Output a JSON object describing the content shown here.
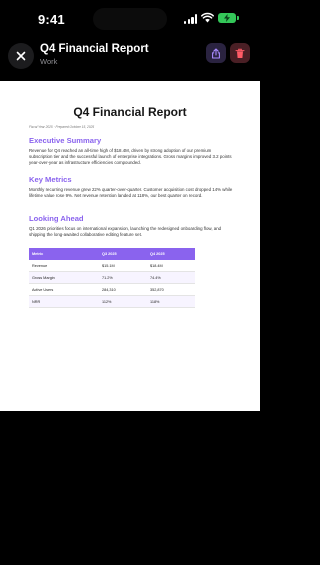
{
  "status_bar": {
    "time": "9:41"
  },
  "header": {
    "title": "Q4 Financial Report",
    "subtitle": "Work"
  },
  "icons": {
    "close": "close-icon",
    "share": "share-icon",
    "delete": "trash-icon",
    "signal": "cellular-signal-icon",
    "wifi": "wifi-icon",
    "battery": "battery-charging-icon"
  },
  "colors": {
    "accent": "#8a63ee",
    "share_bg": "#2a2340",
    "delete_bg": "#4a1f25",
    "battery": "#34c759"
  },
  "document": {
    "title": "Q4 Financial Report",
    "meta": "Fiscal Year 2025 · Prepared October 15, 2025",
    "sections": [
      {
        "heading": "Executive Summary",
        "body": "Revenue for Q4 reached an all-time high of $18.4M, driven by strong adoption of our premium subscription tier and the successful launch of enterprise integrations. Gross margins improved 3.2 points year-over-year as infrastructure efficiencies compounded."
      },
      {
        "heading": "Key Metrics",
        "body": "Monthly recurring revenue grew 22% quarter-over-quarter. Customer acquisition cost dropped 14% while lifetime value rose 9%. Net revenue retention landed at 118%, our best quarter on record."
      },
      {
        "heading": "Looking Ahead",
        "body": "Q1 2026 priorities focus on international expansion, launching the redesigned onboarding flow, and shipping the long-awaited collaborative editing feature set."
      }
    ],
    "table": {
      "headers": [
        "Metric",
        "Q3 2025",
        "Q4 2025"
      ],
      "rows": [
        [
          "Revenue",
          "$15.1M",
          "$18.4M"
        ],
        [
          "Gross Margin",
          "71.2%",
          "74.4%"
        ],
        [
          "Active Users",
          "284,310",
          "352,870"
        ],
        [
          "NRR",
          "112%",
          "118%"
        ]
      ]
    }
  }
}
